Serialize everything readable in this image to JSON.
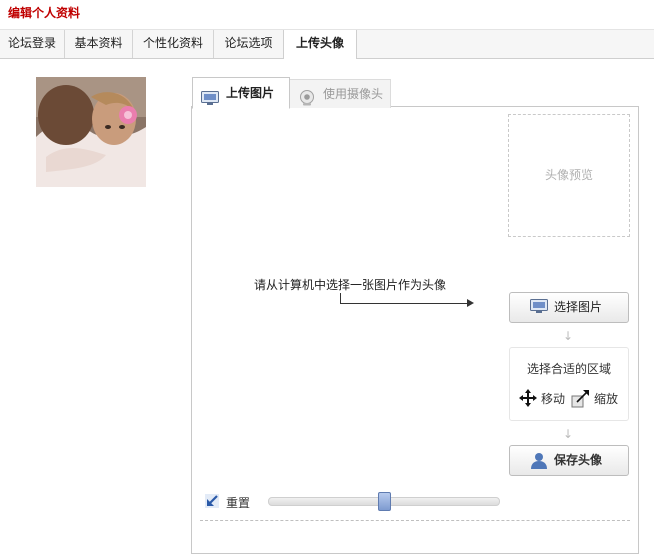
{
  "page": {
    "title": "编辑个人资料"
  },
  "tabs": [
    {
      "label": "论坛登录"
    },
    {
      "label": "基本资料"
    },
    {
      "label": "个性化资料"
    },
    {
      "label": "论坛选项"
    },
    {
      "label": "上传头像",
      "active": true
    }
  ],
  "upload": {
    "tab_upload": "上传图片",
    "tab_camera": "使用摄像头",
    "preview_label": "头像预览",
    "hint": "请从计算机中选择一张图片作为头像",
    "select_button": "选择图片",
    "region_title": "选择合适的区域",
    "move_label": "移动",
    "zoom_label": "缩放",
    "save_button": "保存头像",
    "reset_label": "重置",
    "zoom_level": 0.5
  },
  "icons": {
    "upload_tab": "monitor-icon",
    "camera_tab": "webcam-icon",
    "select": "monitor-icon",
    "move": "move-arrows-icon",
    "zoom": "resize-icon",
    "save": "user-icon",
    "reset": "reset-arrow-icon"
  },
  "colors": {
    "title": "#c00000",
    "accent": "#6f8fc8"
  }
}
